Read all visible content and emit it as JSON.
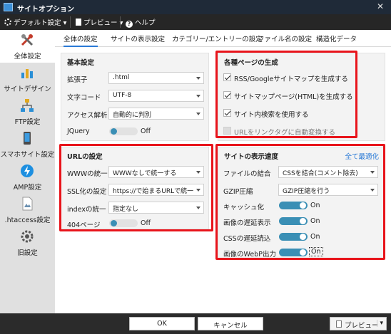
{
  "window": {
    "title": "サイトオプション",
    "close_glyph": "✕"
  },
  "menubar": [
    {
      "label": "デフォルト設定",
      "icon": "gear-icon"
    },
    {
      "label": "プレビュー",
      "icon": "document-icon"
    },
    {
      "label": "ヘルプ",
      "icon": "help-icon"
    }
  ],
  "sidebar": [
    {
      "label": "全体設定",
      "icon": "tools-icon"
    },
    {
      "label": "サイトデザイン",
      "icon": "bar-chart-icon"
    },
    {
      "label": "FTP設定",
      "icon": "network-icon"
    },
    {
      "label": "スマホサイト設定",
      "icon": "smartphone-icon"
    },
    {
      "label": "AMP設定",
      "icon": "lightning-icon"
    },
    {
      "label": ".htaccess設定",
      "icon": "file-config-icon"
    },
    {
      "label": "旧設定",
      "icon": "old-settings-icon"
    }
  ],
  "tabs": [
    "全体の設定",
    "サイトの表示設定",
    "カテゴリー/エントリーの設定",
    "ファイル名の設定",
    "構造化データ"
  ],
  "basic": {
    "title": "基本設定",
    "ext_label": "拡張子",
    "ext_value": ".html",
    "charset_label": "文字コード",
    "charset_value": "UTF-8",
    "access_label": "アクセス解析",
    "access_value": "自動的に判別",
    "jquery_label": "JQuery",
    "jquery_state": "Off"
  },
  "pages": {
    "title": "各種ページの生成",
    "rss": "RSS/Googleサイトマップを生成する",
    "sitemap": "サイトマップページ(HTML)を生成する",
    "search": "サイト内検索を使用する",
    "autolink": "URLをリンクタグに自動変換する"
  },
  "url": {
    "title": "URLの設定",
    "www_label": "WWWの統一",
    "www_value": "WWWなしで統一する",
    "ssl_label": "SSL化の設定",
    "ssl_value": "https://で始まるURLで統一",
    "index_label": "indexの統一",
    "index_value": "指定なし",
    "p404_label": "404ページ",
    "p404_state": "Off"
  },
  "speed": {
    "title": "サイトの表示速度",
    "optimize_all": "全て最適化",
    "combine_label": "ファイルの結合",
    "combine_value": "CSSを結合(コメント除去)",
    "gzip_label": "GZIP圧縮",
    "gzip_value": "GZIP圧縮を行う",
    "cache_label": "キャッシュ化",
    "cache_state": "On",
    "imglazy_label": "画像の遅延表示",
    "imglazy_state": "On",
    "csslazy_label": "CSSの遅延読込",
    "csslazy_state": "On",
    "webp_label": "画像のWebP出力",
    "webp_state": "On"
  },
  "bottom": {
    "ok": "OK",
    "cancel": "キャンセル",
    "preview": "プレビュー"
  },
  "colors": {
    "highlight": "#e8141b",
    "accent": "#2a7ad6",
    "toggle_on": "#3a8fb5"
  }
}
